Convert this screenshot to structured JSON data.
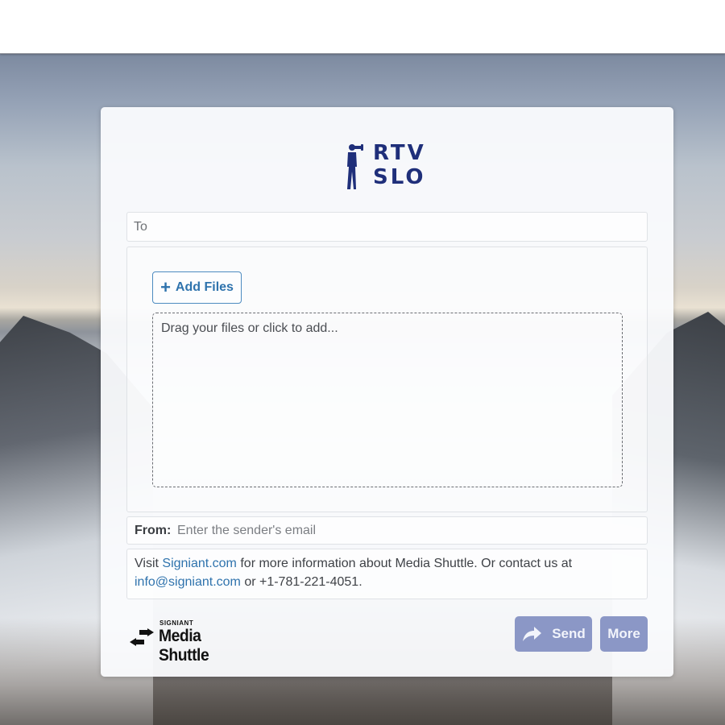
{
  "logo": {
    "text_line1": "RTV",
    "text_line2": "SLO",
    "brand_color": "#1f2f7a"
  },
  "form": {
    "to_label": "To",
    "add_files_label": "Add Files",
    "dropzone_text": "Drag your files or click to add...",
    "from_label": "From:",
    "from_placeholder": "Enter the sender's email",
    "info": {
      "visit": "Visit",
      "site_link": "Signiant.com",
      "middle": "for more information about Media Shuttle. Or contact us at",
      "email_link": "info@signiant.com",
      "phone": "or +1-781-221-4051."
    }
  },
  "footer": {
    "brand_small": "SIGNIANT",
    "brand_name": "Media Shuttle",
    "send_label": "Send",
    "more_label": "More",
    "button_color": "#8b97c6",
    "link_color": "#2f73ad"
  },
  "icons": [
    "videographer-logo-icon",
    "plus-icon",
    "share-arrow-icon",
    "media-shuttle-arrows-icon"
  ]
}
